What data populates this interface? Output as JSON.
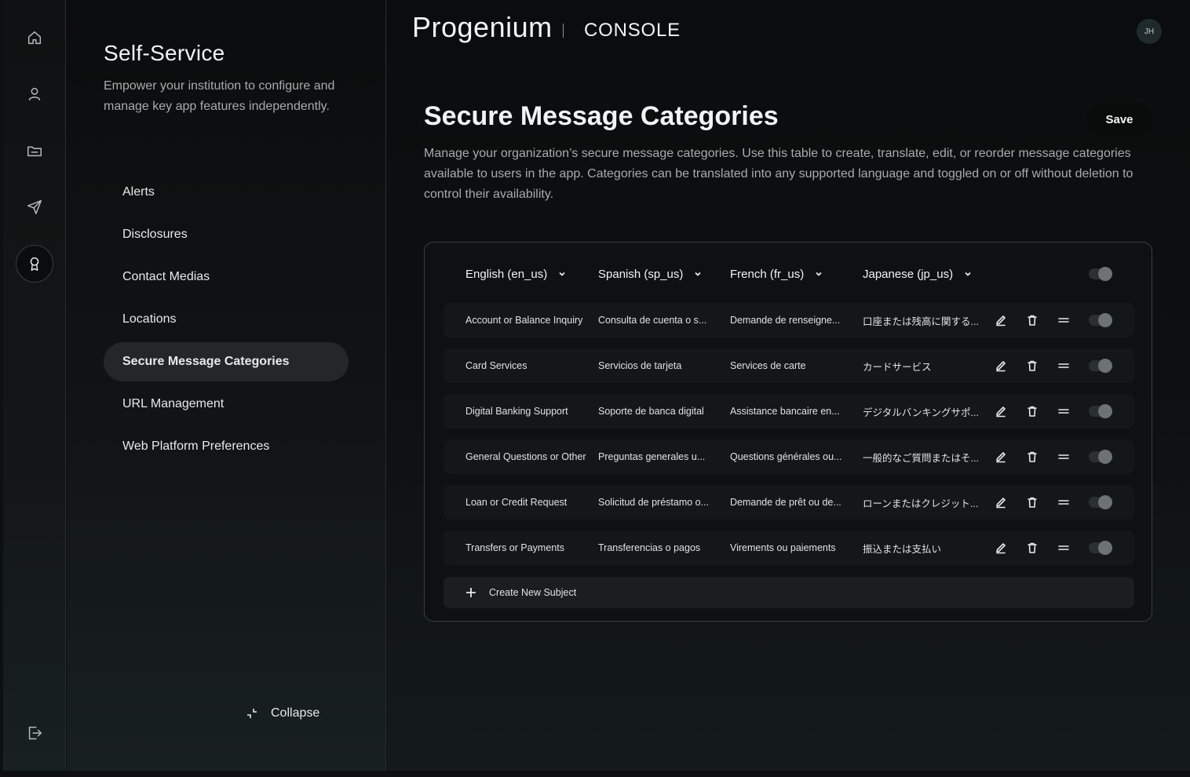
{
  "rail": {
    "items": [
      {
        "name": "home-icon",
        "active": false
      },
      {
        "name": "user-icon",
        "active": false
      },
      {
        "name": "folder-icon",
        "active": false
      },
      {
        "name": "send-icon",
        "active": false
      },
      {
        "name": "award-icon",
        "active": true
      }
    ],
    "logout": "logout-icon"
  },
  "sidebar": {
    "title": "Self-Service",
    "description": "Empower your institution to configure and manage key app features independently.",
    "items": [
      {
        "label": "Alerts"
      },
      {
        "label": "Disclosures"
      },
      {
        "label": "Contact Medias"
      },
      {
        "label": "Locations"
      },
      {
        "label": "Secure Message Categories",
        "active": true
      },
      {
        "label": "URL Management"
      },
      {
        "label": "Web Platform Preferences"
      }
    ],
    "collapse_label": "Collapse"
  },
  "header": {
    "brand": "Progenium",
    "section": "CONSOLE",
    "avatar_initials": "JH"
  },
  "main": {
    "title": "Secure Message Categories",
    "save_label": "Save",
    "description": "Manage your organization’s secure message categories. Use this table to create, translate, edit, or reorder message categories available to users in the app. Categories can be translated into any supported language and toggled on or off without deletion to control their availability."
  },
  "table": {
    "columns": [
      {
        "label": "English (en_us)"
      },
      {
        "label": "Spanish (sp_us)"
      },
      {
        "label": "French (fr_us)"
      },
      {
        "label": "Japanese (jp_us)"
      }
    ],
    "rows": [
      {
        "cells": [
          "Account or Balance Inquiry",
          "Consulta de cuenta o s...",
          "Demande de renseigne...",
          "口座または残高に関する..."
        ],
        "enabled": true
      },
      {
        "cells": [
          "Card Services",
          "Servicios de tarjeta",
          "Services de carte",
          "カードサービス"
        ],
        "enabled": true
      },
      {
        "cells": [
          "Digital Banking Support",
          "Soporte de banca digital",
          "Assistance bancaire en...",
          "デジタルバンキングサポ..."
        ],
        "enabled": true
      },
      {
        "cells": [
          "General Questions or Other",
          "Preguntas generales u...",
          "Questions générales ou...",
          "一般的なご質問またはそ..."
        ],
        "enabled": true
      },
      {
        "cells": [
          "Loan or Credit Request",
          "Solicitud de préstamo o...",
          "Demande de prêt ou de...",
          "ローンまたはクレジット..."
        ],
        "enabled": true
      },
      {
        "cells": [
          "Transfers or Payments",
          "Transferencias o pagos",
          "Virements ou paiements",
          "振込または支払い"
        ],
        "enabled": true
      }
    ],
    "create_label": "Create New Subject",
    "colors": {
      "row_bg": "#141718",
      "toggle_knob": "#6d7273"
    }
  }
}
